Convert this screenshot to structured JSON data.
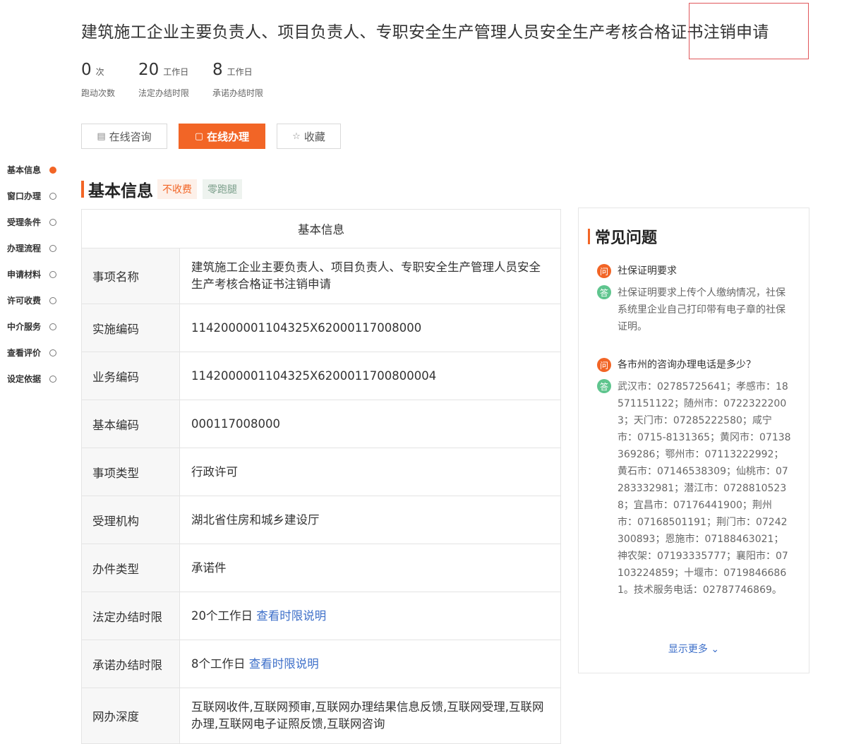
{
  "page_title": "建筑施工企业主要负责人、项目负责人、专职安全生产管理人员安全生产考核合格证书注销申请",
  "stats": [
    {
      "value": "0",
      "unit": "次",
      "label": "跑动次数"
    },
    {
      "value": "20",
      "unit": "工作日",
      "label": "法定办结时限"
    },
    {
      "value": "8",
      "unit": "工作日",
      "label": "承诺办结时限"
    }
  ],
  "actions": {
    "consult": "在线咨询",
    "handle": "在线办理",
    "favorite": "收藏"
  },
  "sidenav": [
    {
      "label": "基本信息",
      "active": true
    },
    {
      "label": "窗口办理",
      "active": false
    },
    {
      "label": "受理条件",
      "active": false
    },
    {
      "label": "办理流程",
      "active": false
    },
    {
      "label": "申请材料",
      "active": false
    },
    {
      "label": "许可收费",
      "active": false
    },
    {
      "label": "中介服务",
      "active": false
    },
    {
      "label": "查看评价",
      "active": false
    },
    {
      "label": "设定依据",
      "active": false
    }
  ],
  "section": {
    "title": "基本信息",
    "tags": [
      "不收费",
      "零跑腿"
    ]
  },
  "table": {
    "header": "基本信息",
    "rows": [
      {
        "key": "事项名称",
        "value": "建筑施工企业主要负责人、项目负责人、专职安全生产管理人员安全生产考核合格证书注销申请"
      },
      {
        "key": "实施编码",
        "value": "1142000001104325X62000117008000"
      },
      {
        "key": "业务编码",
        "value": "1142000001104325X6200011700800004"
      },
      {
        "key": "基本编码",
        "value": "000117008000"
      },
      {
        "key": "事项类型",
        "value": "行政许可"
      },
      {
        "key": "受理机构",
        "value": "湖北省住房和城乡建设厅"
      },
      {
        "key": "办件类型",
        "value": "承诺件"
      },
      {
        "key": "法定办结时限",
        "value": "20个工作日",
        "link": "查看时限说明"
      },
      {
        "key": "承诺办结时限",
        "value": "8个工作日",
        "link": "查看时限说明"
      },
      {
        "key": "网办深度",
        "value": "互联网收件,互联网预审,互联网办理结果信息反馈,互联网受理,互联网办理,互联网电子证照反馈,互联网咨询"
      }
    ]
  },
  "faq": {
    "title": "常见问题",
    "q_badge": "问",
    "a_badge": "答",
    "items": [
      {
        "q": "社保证明要求",
        "a": "社保证明要求上传个人缴纳情况，社保系统里企业自己打印带有电子章的社保证明。"
      },
      {
        "q": "各市州的咨询办理电话是多少？",
        "a": "武汉市：02785725641；孝感市：18571151122；随州市：07223222003；天门市：07285222580；咸宁市：0715-8131365；黄冈市：07138369286；鄂州市：07113222992；黄石市：07146538309；仙桃市：07283332981；潜江市：07288105238；宜昌市：07176441900；荆州市：07168501191；荆门市：07242300893；恩施市：07188463021；神农架：07193335777；襄阳市：07103224859；十堰市：07198466861。技术服务电话：02787746869。"
      }
    ],
    "more": "显示更多"
  },
  "colors": {
    "accent": "#f26526",
    "link": "#3d6fc9",
    "answer": "#5fc58e"
  }
}
